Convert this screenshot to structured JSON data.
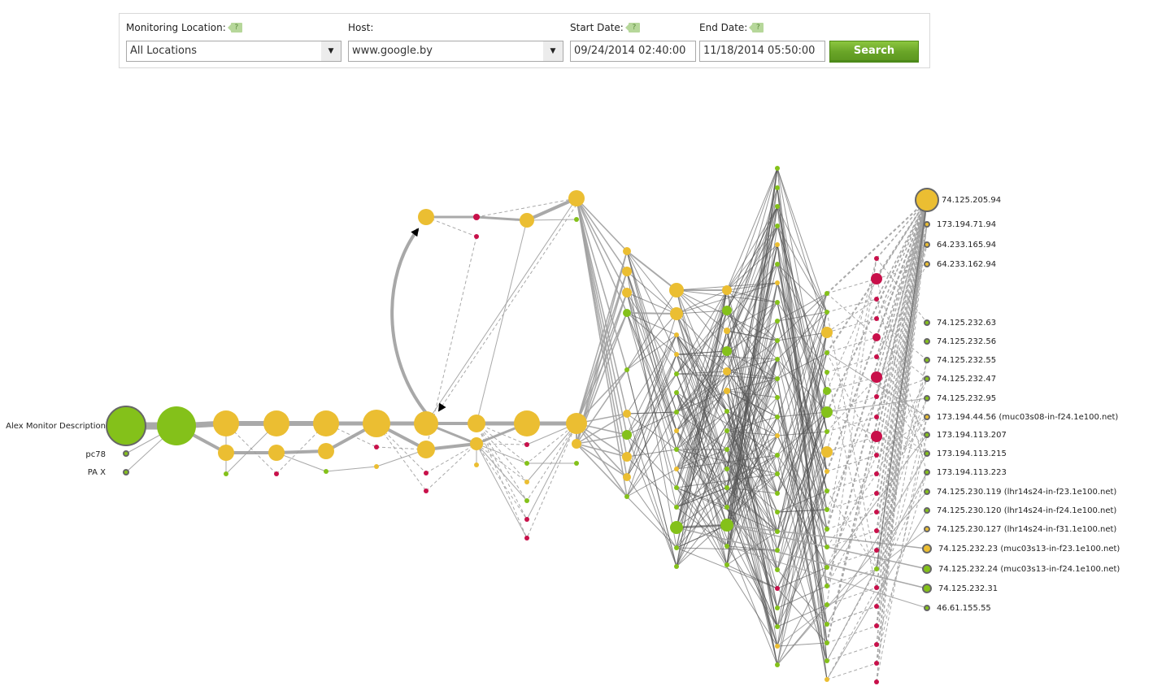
{
  "filters": {
    "location_label": "Monitoring Location:",
    "location_value": "All Locations",
    "host_label": "Host:",
    "host_value": "www.google.by",
    "start_label": "Start Date:",
    "start_value": "09/24/2014 02:40:00",
    "end_label": "End Date:",
    "end_value": "11/18/2014 05:50:00",
    "help_icon": "?",
    "dropdown_icon": "▼",
    "search_label": "Search"
  },
  "colors": {
    "green": "#84c11a",
    "yellow": "#ebbe32",
    "red": "#c8104a",
    "edge": "#9a9a9a",
    "outline": "#666666"
  },
  "source_labels": [
    "Alex Monitor Description",
    "pc78",
    "PA X"
  ],
  "destinations": [
    {
      "label": "74.125.205.94",
      "status": "yellow",
      "size": "large"
    },
    {
      "label": "173.194.71.94",
      "status": "yellow",
      "size": "small"
    },
    {
      "label": "64.233.165.94",
      "status": "yellow",
      "size": "small"
    },
    {
      "label": "64.233.162.94",
      "status": "yellow",
      "size": "small"
    },
    {
      "label": "74.125.232.63",
      "status": "green",
      "size": "small"
    },
    {
      "label": "74.125.232.56",
      "status": "green",
      "size": "small"
    },
    {
      "label": "74.125.232.55",
      "status": "green",
      "size": "small"
    },
    {
      "label": "74.125.232.47",
      "status": "green",
      "size": "small"
    },
    {
      "label": "74.125.232.95",
      "status": "green",
      "size": "small"
    },
    {
      "label": "173.194.44.56 (muc03s08-in-f24.1e100.net)",
      "status": "yellow",
      "size": "small"
    },
    {
      "label": "173.194.113.207",
      "status": "green",
      "size": "small"
    },
    {
      "label": "173.194.113.215",
      "status": "green",
      "size": "small"
    },
    {
      "label": "173.194.113.223",
      "status": "green",
      "size": "small"
    },
    {
      "label": "74.125.230.119 (lhr14s24-in-f23.1e100.net)",
      "status": "green",
      "size": "small"
    },
    {
      "label": "74.125.230.120 (lhr14s24-in-f24.1e100.net)",
      "status": "green",
      "size": "small"
    },
    {
      "label": "74.125.230.127 (lhr14s24-in-f31.1e100.net)",
      "status": "yellow",
      "size": "small"
    },
    {
      "label": "74.125.232.23 (muc03s13-in-f23.1e100.net)",
      "status": "yellow",
      "size": "medium"
    },
    {
      "label": "74.125.232.24 (muc03s13-in-f24.1e100.net)",
      "status": "green",
      "size": "medium"
    },
    {
      "label": "74.125.232.31",
      "status": "green",
      "size": "medium"
    },
    {
      "label": "46.61.155.55",
      "status": "green",
      "size": "small"
    }
  ],
  "diagram": {
    "type": "network-traceroute-graph",
    "node_status_legend": [
      "green",
      "yellow",
      "red"
    ]
  }
}
